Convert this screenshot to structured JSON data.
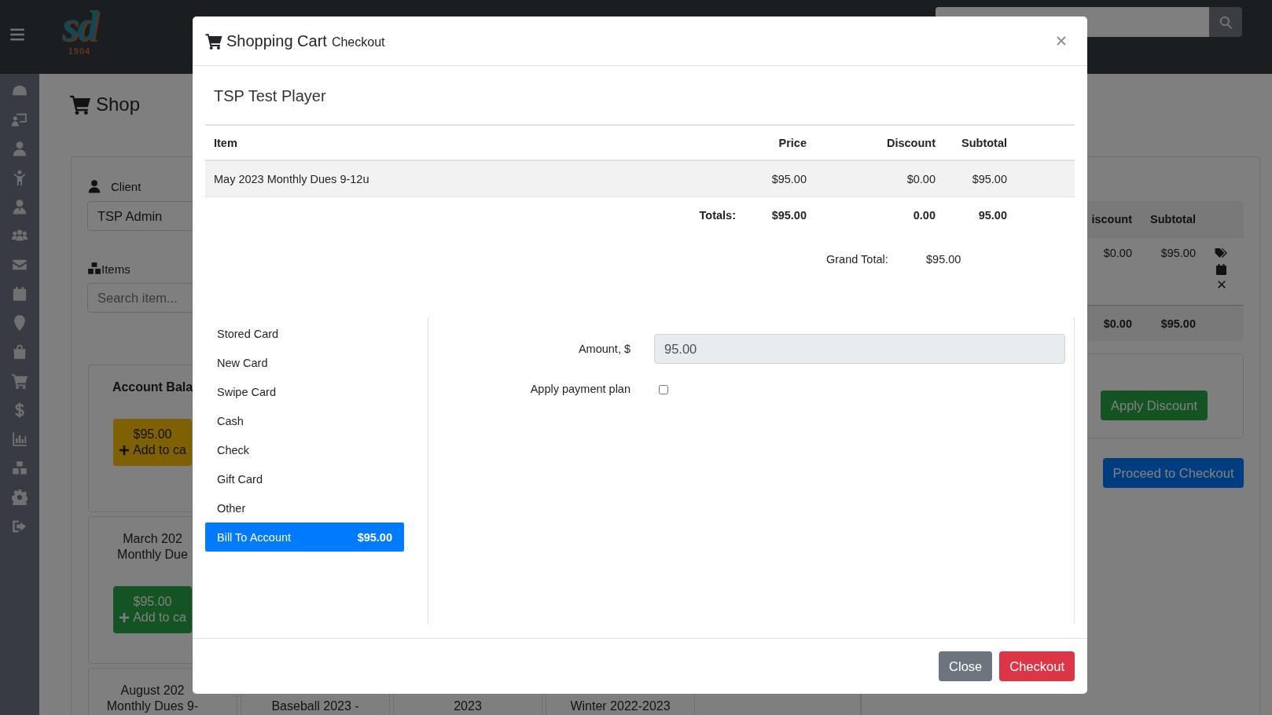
{
  "navbar": {
    "logo": {
      "mark": "sd",
      "year": "1904"
    }
  },
  "page": {
    "title": "Shop",
    "client": {
      "label": "Client",
      "value": "TSP Admin"
    },
    "items": {
      "label": "Items",
      "placeholder": "Search item..."
    },
    "product_rows": [
      [
        {
          "kind": "balance",
          "lines": [
            "Account Bala"
          ],
          "button": {
            "price": "$95.00",
            "label": "Add to ca"
          }
        }
      ],
      [
        {
          "kind": "product",
          "lines": [
            "March 202",
            "Monthly Due"
          ],
          "button": {
            "price": "$95.00",
            "label": "Add to ca"
          }
        }
      ],
      [
        {
          "kind": "product",
          "lines": [
            "August 202",
            "Monthly Dues 9-"
          ]
        },
        {
          "kind": "product",
          "lines": [
            "Baseball 2023 -"
          ]
        },
        {
          "kind": "product",
          "lines": [
            "2023"
          ]
        },
        {
          "kind": "product",
          "lines": [
            "Winter 2022-2023"
          ]
        }
      ]
    ],
    "cart": {
      "columns": [
        "iscount",
        "Subtotal"
      ],
      "rows": [
        {
          "discount": "$0.00",
          "subtotal": "$95.00"
        }
      ],
      "totals": {
        "discount": "$0.00",
        "subtotal": "$95.00"
      },
      "discount_button": "Apply Discount",
      "checkout_button": "Proceed to Checkout"
    }
  },
  "modal": {
    "title": "Shopping Cart",
    "subtitle": "Checkout",
    "customer": "TSP Test Player",
    "columns": [
      "Item",
      "Price",
      "Discount",
      "Subtotal"
    ],
    "rows": [
      {
        "item": "May 2023 Monthly Dues 9-12u",
        "price": "$95.00",
        "discount": "$0.00",
        "subtotal": "$95.00"
      }
    ],
    "totals": {
      "label": "Totals:",
      "price": "$95.00",
      "discount": "0.00",
      "subtotal": "95.00"
    },
    "grand_total": {
      "label": "Grand Total:",
      "value": "$95.00"
    },
    "payment_methods": [
      {
        "label": "Stored Card",
        "selected": false
      },
      {
        "label": "New Card",
        "selected": false
      },
      {
        "label": "Swipe Card",
        "selected": false
      },
      {
        "label": "Cash",
        "selected": false
      },
      {
        "label": "Check",
        "selected": false
      },
      {
        "label": "Gift Card",
        "selected": false
      },
      {
        "label": "Other",
        "selected": false
      },
      {
        "label": "Bill To Account",
        "selected": true,
        "amount": "$95.00"
      }
    ],
    "amount": {
      "label": "Amount, $",
      "value": "95.00",
      "readonly": true
    },
    "payment_plan": {
      "label": "Apply payment plan",
      "checked": false
    },
    "buttons": [
      {
        "label": "Close",
        "kind": "secondary"
      },
      {
        "label": "Checkout",
        "kind": "danger"
      }
    ]
  }
}
